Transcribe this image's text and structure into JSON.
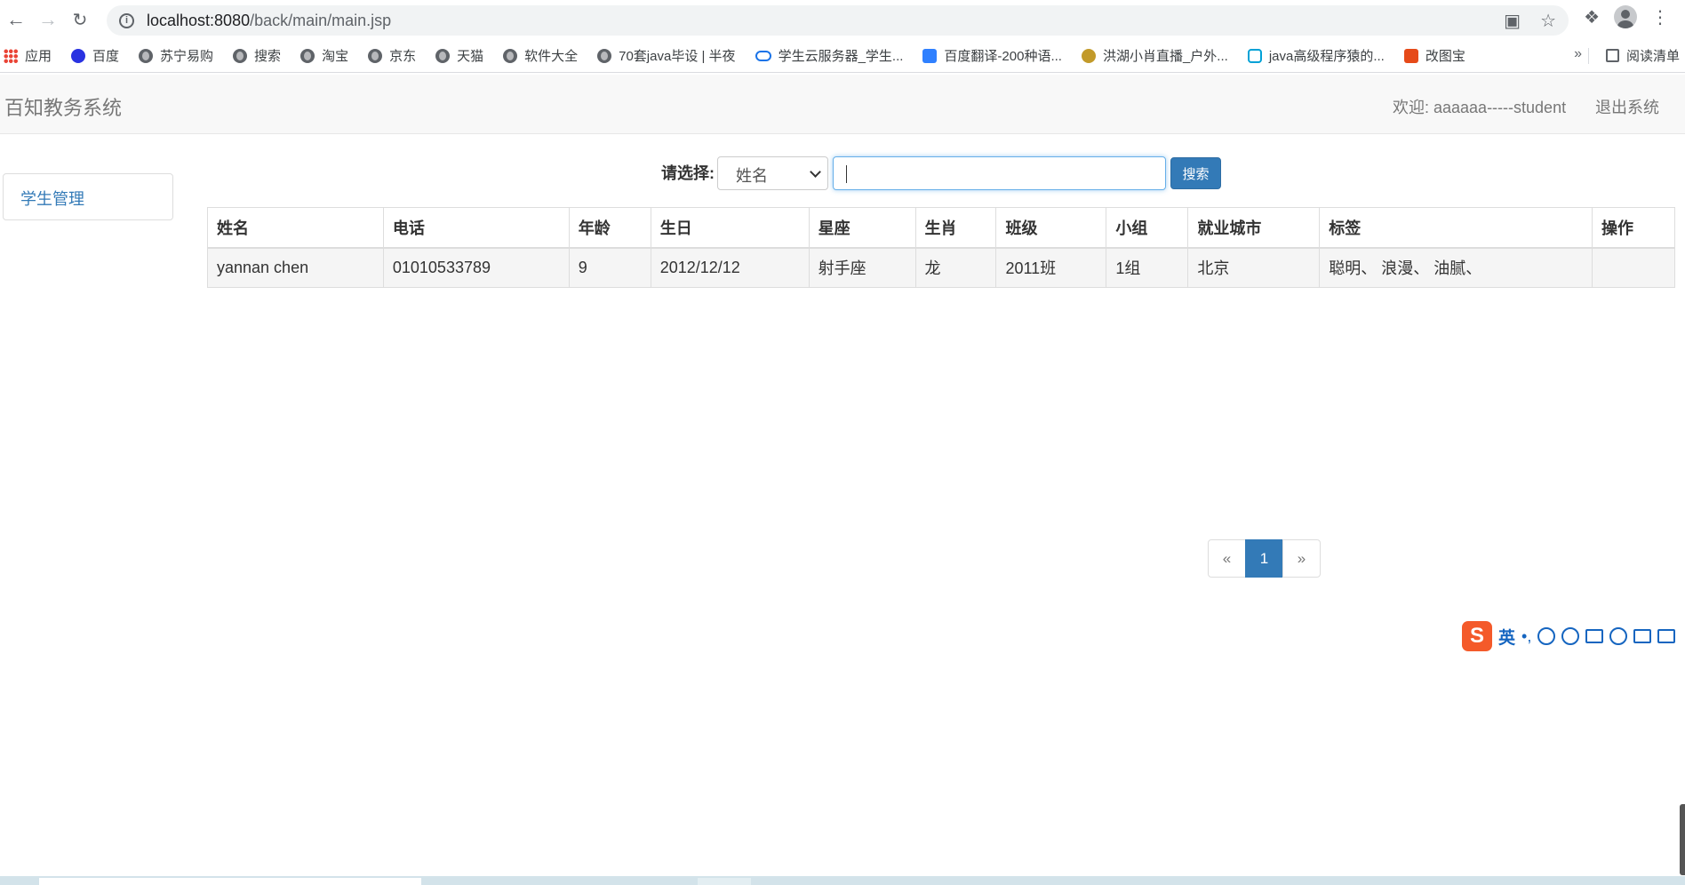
{
  "browser": {
    "url_host": "localhost:8080",
    "url_path": "/back/main/main.jsp",
    "bookmarks": [
      {
        "label": "应用",
        "icon": "apps-icon"
      },
      {
        "label": "百度",
        "icon": "baidu-icon"
      },
      {
        "label": "苏宁易购",
        "icon": "globe-icon"
      },
      {
        "label": "搜索",
        "icon": "globe-icon"
      },
      {
        "label": "淘宝",
        "icon": "globe-icon"
      },
      {
        "label": "京东",
        "icon": "globe-icon"
      },
      {
        "label": "天猫",
        "icon": "globe-icon"
      },
      {
        "label": "软件大全",
        "icon": "globe-icon"
      },
      {
        "label": "70套java毕设 | 半夜",
        "icon": "globe-icon"
      },
      {
        "label": "学生云服务器_学生...",
        "icon": "cloud-icon"
      },
      {
        "label": "百度翻译-200种语...",
        "icon": "translate-icon"
      },
      {
        "label": "洪湖小肖直播_户外...",
        "icon": "huya-icon"
      },
      {
        "label": "java高级程序猿的...",
        "icon": "bilibili-icon"
      },
      {
        "label": "改图宝",
        "icon": "gaitubao-icon"
      }
    ],
    "more": "»",
    "reading_list": "阅读清单"
  },
  "app": {
    "brand": "百知教务系统",
    "welcome": "欢迎: aaaaaa-----student",
    "logout": "退出系统"
  },
  "sidebar": {
    "items": [
      {
        "label": "学生管理"
      }
    ]
  },
  "search": {
    "label": "请选择:",
    "selected": "姓名",
    "input_value": "",
    "button": "搜索"
  },
  "table": {
    "headers": [
      "姓名",
      "电话",
      "年龄",
      "生日",
      "星座",
      "生肖",
      "班级",
      "小组",
      "就业城市",
      "标签",
      "操作"
    ],
    "rows": [
      [
        "yannan chen",
        "01010533789",
        "9",
        "2012/12/12",
        "射手座",
        "龙",
        "2011班",
        "1组",
        "北京",
        "聪明、 浪漫、 油腻、",
        ""
      ]
    ]
  },
  "pagination": {
    "prev": "«",
    "current": "1",
    "next": "»"
  },
  "ime": {
    "logo": "S",
    "lang": "英",
    "punct": "•,"
  },
  "colors": {
    "primary": "#337ab7",
    "navbar_bg": "#f8f8f8",
    "row_bg": "#f5f5f5"
  }
}
